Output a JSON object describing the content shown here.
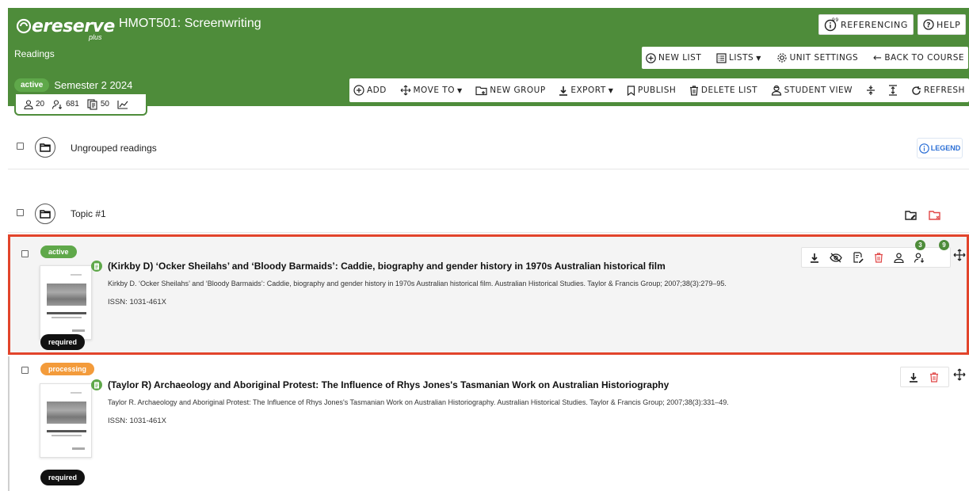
{
  "header": {
    "logo_text": "ereserve",
    "logo_plus": "plus",
    "course_title": "HMOT501: Screenwriting",
    "section_label": "Readings",
    "status_pill": "active",
    "semester": "Semester 2 2024",
    "stats": {
      "students": "20",
      "views": "681",
      "readings": "50"
    },
    "referencing_label": "REFERENCING",
    "help_label": "HELP"
  },
  "toolbar_top": {
    "new_list": "NEW LIST",
    "lists": "LISTS",
    "unit_settings": "UNIT SETTINGS",
    "back_to_course": "BACK TO COURSE"
  },
  "toolbar": {
    "add": "ADD",
    "move_to": "MOVE TO",
    "new_group": "NEW GROUP",
    "export": "EXPORT",
    "publish": "PUBLISH",
    "delete_list": "DELETE LIST",
    "student_view": "STUDENT VIEW",
    "refresh": "REFRESH"
  },
  "legend_label": "LEGEND",
  "groups": [
    {
      "name": "Ungrouped readings"
    },
    {
      "name": "Topic #1"
    }
  ],
  "readings": [
    {
      "status": "active",
      "title": "(Kirkby D) ‘Ocker Sheilahs’ and ‘Bloody Barmaids’: Caddie, biography and gender history in 1970s Australian historical film",
      "citation": "Kirkby D. ‘Ocker Sheilahs’ and ‘Bloody Barmaids’: Caddie, biography and gender history in 1970s Australian historical film. Australian Historical Studies. Taylor & Francis Group; 2007;38(3):279–95.",
      "issn": "ISSN: 1031-461X",
      "tag": "required",
      "badge_students": "3",
      "badge_views": "9"
    },
    {
      "status": "processing",
      "title": "(Taylor R) Archaeology and Aboriginal Protest: The Influence of Rhys Jones's Tasmanian Work on Australian Historiography",
      "citation": "Taylor R. Archaeology and Aboriginal Protest: The Influence of Rhys Jones's Tasmanian Work on Australian Historiography. Australian Historical Studies. Taylor & Francis Group; 2007;38(3):331–49.",
      "issn": "ISSN: 1031-461X",
      "tag": "required"
    }
  ],
  "colors": {
    "header_green": "#4e8c3a",
    "active_green": "#5fa84a",
    "processing_orange": "#f39b3b",
    "highlight_red": "#e2442b",
    "delete_red": "#e04646",
    "legend_blue": "#2b6fd6"
  }
}
